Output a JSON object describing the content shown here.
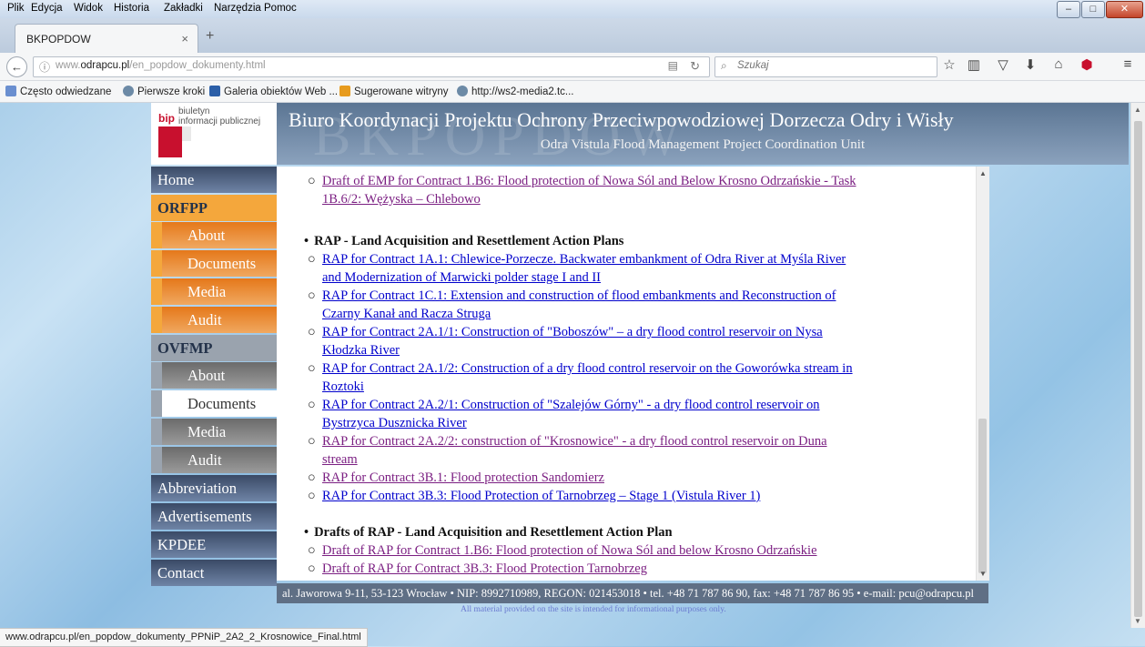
{
  "menu": [
    "Plik",
    "Edycja",
    "Widok",
    "Historia",
    "Zakładki",
    "Narzędzia",
    "Pomoc"
  ],
  "tab": {
    "title": "BKPOPDOW",
    "close": "×",
    "new": "+"
  },
  "address": {
    "prefix": "www.",
    "host": "odrapcu.pl",
    "path": "/en_popdow_dokumenty.html"
  },
  "search": {
    "placeholder": "Szukaj"
  },
  "bookmarks": [
    "Często odwiedzane",
    "Pierwsze kroki",
    "Galeria obiektów Web ...",
    "Sugerowane witryny",
    "http://ws2-media2.tc..."
  ],
  "header": {
    "logo_mark": "bip",
    "logo_text": [
      "biuletyn",
      "informacji publicznej"
    ],
    "watermark": "BKPOPDOW",
    "title": "Biuro Koordynacji Projektu Ochrony Przeciwpowodziowej Dorzecza Odry i Wisły",
    "subtitle": "Odra Vistula Flood Management Project Coordination Unit"
  },
  "nav": {
    "home": "Home",
    "orfpp": "ORFPP",
    "orfpp_items": [
      "About",
      "Documents",
      "Media",
      "Audit"
    ],
    "ovfmp": "OVFMP",
    "ovfmp_items": [
      "About",
      "Documents",
      "Media",
      "Audit"
    ],
    "abbreviation": "Abbreviation",
    "advertisements": "Advertisements",
    "kpdee": "KPDEE",
    "contact": "Contact"
  },
  "content": {
    "top_item": [
      "Draft of EMP for Contract 1.B6: Flood protection of Nowa Sól and Below Krosno Odrzańskie - Task",
      "1B.6/2: Wężyska – Chlebowo"
    ],
    "section1": "RAP - Land Acquisition and Resettlement Action Plans",
    "rap_items": [
      [
        "RAP for Contract 1A.1: Chlewice-Porzecze. Backwater embankment of Odra River at Myśla River",
        "and Modernization of Marwicki polder stage I and II"
      ],
      [
        "RAP for Contract 1C.1: Extension and construction of flood embankments and Reconstruction of",
        "Czarny Kanał and Racza Struga"
      ],
      [
        "RAP for Contract 2A.1/1: Construction of \"Boboszów\" – a dry flood control reservoir on Nysa",
        "Kłodzka River"
      ],
      [
        "RAP for Contract 2A.1/2: Construction of a dry flood control reservoir on the Goworówka stream in",
        "Roztoki"
      ],
      [
        "RAP for Contract 2A.2/1: Construction of \"Szalejów Górny\" - a dry flood control reservoir on",
        "Bystrzyca Dusznicka River"
      ],
      [
        "RAP for Contract 2A.2/2: construction of \"Krosnowice\" - a dry flood control reservoir on Duna",
        "stream"
      ],
      [
        "RAP for Contract 3B.1: Flood protection Sandomierz"
      ],
      [
        "RAP for Contract 3B.3: Flood Protection of Tarnobrzeg – Stage 1 (Vistula River 1)"
      ]
    ],
    "section2": "Drafts of RAP - Land Acquisition and Resettlement Action Plan",
    "draft_items": [
      "Draft of RAP for Contract 1.B6: Flood protection of Nowa Sól and below Krosno Odrzańskie",
      "Draft of RAP for Contract 3B.3: Flood Protection Tarnobrzeg"
    ]
  },
  "footer": "al. Jaworowa 9-11, 53-123 Wrocław • NIP: 8992710989, REGON: 021453018 • tel. +48 71 787 86 90, fax: +48 71 787 86 95 • e-mail: pcu@odrapcu.pl",
  "footer_note": "All material provided on the site is intended for informational purposes only.",
  "status_url": "www.odrapcu.pl/en_popdow_dokumenty_PPNiP_2A2_2_Krosnowice_Final.html",
  "colors": {
    "link": "#0000cc",
    "visited": "#7b1f82",
    "orange": "#f4a73c",
    "nav_blue": "#3a4a66"
  }
}
